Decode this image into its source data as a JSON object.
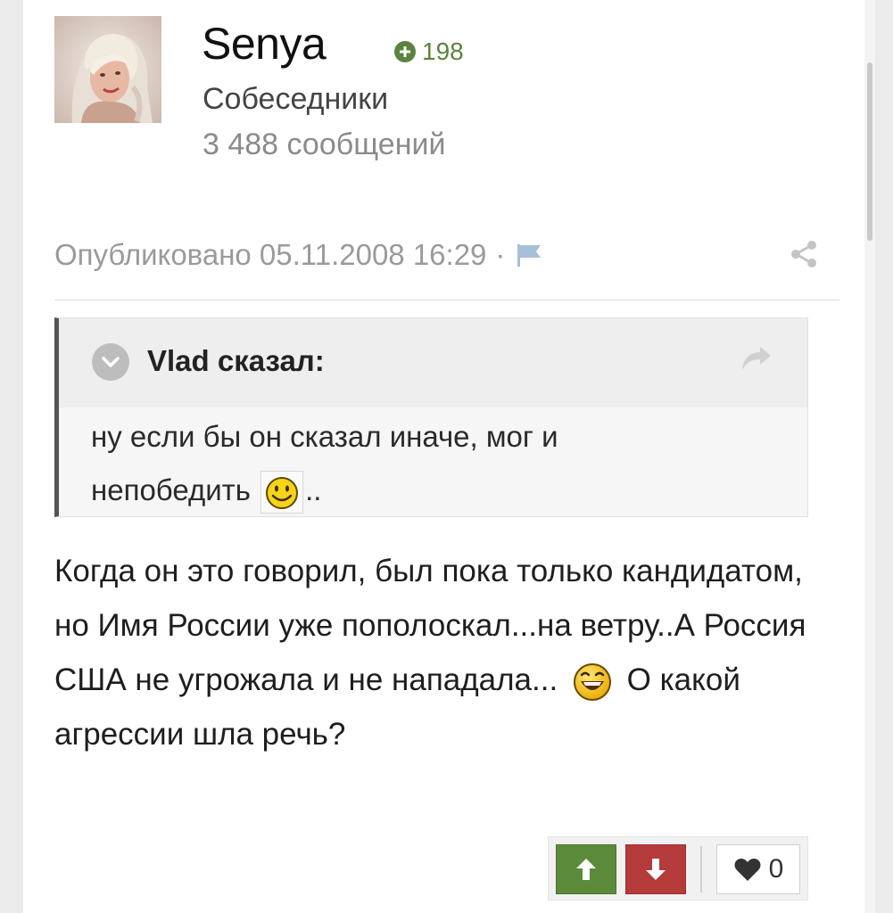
{
  "author": {
    "username": "Senya",
    "reputation": "198",
    "group": "Собеседники",
    "post_count": "3 488 сообщений"
  },
  "meta": {
    "published": "Опубликовано 05.11.2008 16:29",
    "separator": "·"
  },
  "quote": {
    "author": "Vlad сказал:",
    "text_line1": "ну если бы он сказал иначе, мог и",
    "text_line2": "непобедить",
    "text_after_emoji": ".."
  },
  "post": {
    "text_before_emoji": "Когда он это говорил, был пока только кандидатом, но Имя России уже пополоскал...на ветру..А Россия США не угрожала и не нападала...",
    "text_after_emoji": "О какой агрессии шла речь?"
  },
  "reactions": {
    "like_count": "0"
  },
  "icons": {
    "reputation": "plus-circle-icon",
    "report": "flag-icon",
    "share": "share-icon",
    "quote_toggle": "chevron-down-icon",
    "quote_forward": "share-arrow-icon",
    "upvote": "arrow-up-icon",
    "downvote": "arrow-down-icon",
    "like": "heart-icon"
  },
  "colors": {
    "reputation_green": "#5b8340",
    "upvote_green": "#5b8a3b",
    "downvote_red": "#b53a3a"
  }
}
